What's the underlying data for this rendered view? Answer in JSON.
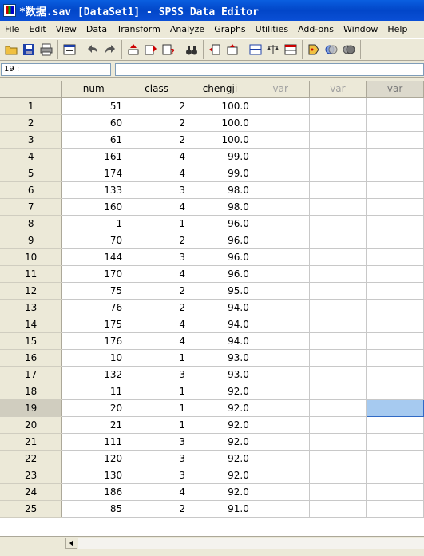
{
  "window": {
    "title": "*数据.sav [DataSet1] - SPSS Data Editor"
  },
  "menu": [
    "File",
    "Edit",
    "View",
    "Data",
    "Transform",
    "Analyze",
    "Graphs",
    "Utilities",
    "Add-ons",
    "Window",
    "Help"
  ],
  "cell_ref": "19 :",
  "columns": [
    {
      "name": "num",
      "is_var": false
    },
    {
      "name": "class",
      "is_var": false
    },
    {
      "name": "chengji",
      "is_var": false
    },
    {
      "name": "var",
      "is_var": true
    },
    {
      "name": "var",
      "is_var": true
    },
    {
      "name": "var",
      "is_var": true
    }
  ],
  "rows": [
    {
      "n": "1",
      "num": "51",
      "class": "2",
      "chengji": "100.0"
    },
    {
      "n": "2",
      "num": "60",
      "class": "2",
      "chengji": "100.0"
    },
    {
      "n": "3",
      "num": "61",
      "class": "2",
      "chengji": "100.0"
    },
    {
      "n": "4",
      "num": "161",
      "class": "4",
      "chengji": "99.0"
    },
    {
      "n": "5",
      "num": "174",
      "class": "4",
      "chengji": "99.0"
    },
    {
      "n": "6",
      "num": "133",
      "class": "3",
      "chengji": "98.0"
    },
    {
      "n": "7",
      "num": "160",
      "class": "4",
      "chengji": "98.0"
    },
    {
      "n": "8",
      "num": "1",
      "class": "1",
      "chengji": "96.0"
    },
    {
      "n": "9",
      "num": "70",
      "class": "2",
      "chengji": "96.0"
    },
    {
      "n": "10",
      "num": "144",
      "class": "3",
      "chengji": "96.0"
    },
    {
      "n": "11",
      "num": "170",
      "class": "4",
      "chengji": "96.0"
    },
    {
      "n": "12",
      "num": "75",
      "class": "2",
      "chengji": "95.0"
    },
    {
      "n": "13",
      "num": "76",
      "class": "2",
      "chengji": "94.0"
    },
    {
      "n": "14",
      "num": "175",
      "class": "4",
      "chengji": "94.0"
    },
    {
      "n": "15",
      "num": "176",
      "class": "4",
      "chengji": "94.0"
    },
    {
      "n": "16",
      "num": "10",
      "class": "1",
      "chengji": "93.0"
    },
    {
      "n": "17",
      "num": "132",
      "class": "3",
      "chengji": "93.0"
    },
    {
      "n": "18",
      "num": "11",
      "class": "1",
      "chengji": "92.0"
    },
    {
      "n": "19",
      "num": "20",
      "class": "1",
      "chengji": "92.0"
    },
    {
      "n": "20",
      "num": "21",
      "class": "1",
      "chengji": "92.0"
    },
    {
      "n": "21",
      "num": "111",
      "class": "3",
      "chengji": "92.0"
    },
    {
      "n": "22",
      "num": "120",
      "class": "3",
      "chengji": "92.0"
    },
    {
      "n": "23",
      "num": "130",
      "class": "3",
      "chengji": "92.0"
    },
    {
      "n": "24",
      "num": "186",
      "class": "4",
      "chengji": "92.0"
    },
    {
      "n": "25",
      "num": "85",
      "class": "2",
      "chengji": "91.0"
    }
  ],
  "active_row": "19",
  "toolbar": [
    [
      "open-folder-icon",
      "save-icon",
      "print-icon"
    ],
    [
      "dialog-recall-icon"
    ],
    [
      "undo-icon",
      "redo-icon"
    ],
    [
      "goto-case-icon",
      "variables-icon",
      "find-icon"
    ],
    [
      "binoculars-icon"
    ],
    [
      "insert-cases-icon",
      "insert-variable-icon"
    ],
    [
      "split-file-icon",
      "weight-cases-icon",
      "select-cases-icon"
    ],
    [
      "value-labels-icon",
      "use-sets-icon",
      "show-all-icon"
    ]
  ],
  "colors": {
    "title_bar": "#0a4fd6",
    "selection": "#a6caf0",
    "chrome": "#ece9d8"
  }
}
